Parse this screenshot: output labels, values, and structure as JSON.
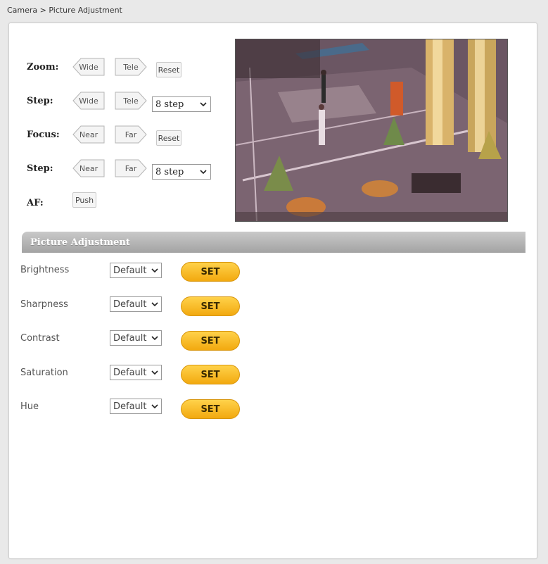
{
  "breadcrumb": "Camera > Picture Adjustment",
  "controls": {
    "zoom": {
      "label": "Zoom:",
      "wide": "Wide",
      "tele": "Tele",
      "reset": "Reset"
    },
    "zoom_step": {
      "label": "Step:",
      "wide": "Wide",
      "tele": "Tele",
      "value": "8 step"
    },
    "focus": {
      "label": "Focus:",
      "near": "Near",
      "far": "Far",
      "reset": "Reset"
    },
    "focus_step": {
      "label": "Step:",
      "near": "Near",
      "far": "Far",
      "value": "8 step"
    },
    "af": {
      "label": "AF:",
      "push": "Push"
    }
  },
  "section_title": "Picture Adjustment",
  "adjustments": [
    {
      "label": "Brightness",
      "value": "Default",
      "button": "SET"
    },
    {
      "label": "Sharpness",
      "value": "Default",
      "button": "SET"
    },
    {
      "label": "Contrast",
      "value": "Default",
      "button": "SET"
    },
    {
      "label": "Saturation",
      "value": "Default",
      "button": "SET"
    },
    {
      "label": "Hue",
      "value": "Default",
      "button": "SET"
    }
  ],
  "colors": {
    "set_button": "#f5b320",
    "header_gray": "#b3b3b3"
  }
}
